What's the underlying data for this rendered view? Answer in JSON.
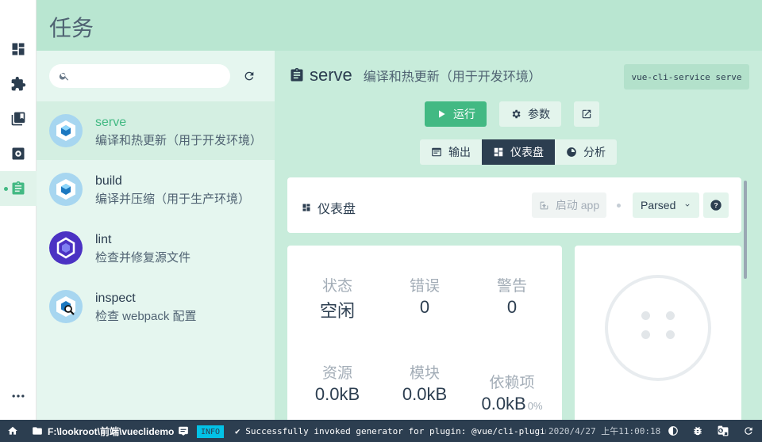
{
  "header": {
    "title": "任务"
  },
  "sidebar": {
    "icons": [
      "dashboard-icon",
      "plugins-icon",
      "dependencies-icon",
      "config-icon",
      "tasks-icon"
    ],
    "more": "more-icon"
  },
  "task_list": {
    "search_placeholder": "",
    "tasks": [
      {
        "name": "serve",
        "desc": "编译和热更新（用于开发环境）",
        "selected": true
      },
      {
        "name": "build",
        "desc": "编译并压缩（用于生产环境）",
        "selected": false
      },
      {
        "name": "lint",
        "desc": "检查并修复源文件",
        "selected": false
      },
      {
        "name": "inspect",
        "desc": "检查 webpack 配置",
        "selected": false
      }
    ]
  },
  "task_detail": {
    "name": "serve",
    "desc": "编译和热更新（用于开发环境）",
    "command": "vue-cli-service serve",
    "run_label": "运行",
    "params_label": "参数",
    "tabs": [
      {
        "label": "输出",
        "active": false
      },
      {
        "label": "仪表盘",
        "active": true
      },
      {
        "label": "分析",
        "active": false
      }
    ]
  },
  "dashboard": {
    "title": "仪表盘",
    "start_app_label": "启动 app",
    "mode_select": "Parsed",
    "stats": [
      {
        "label": "状态",
        "value": "空闲"
      },
      {
        "label": "错误",
        "value": "0"
      },
      {
        "label": "警告",
        "value": "0"
      },
      {
        "label": "资源",
        "value": "0.0kB"
      },
      {
        "label": "模块",
        "value": "0.0kB"
      },
      {
        "label": "依赖项",
        "value": "0.0kB",
        "pct": "0%"
      }
    ]
  },
  "statusbar": {
    "path": "F:\\lookroot\\前端\\vueclidemo",
    "log_level": "INFO",
    "log_message": "✔ Successfully invoked generator for plugin: @vue/cli-plugin-ro…",
    "timestamp": "2020/4/27 上午11:00:18"
  },
  "colors": {
    "accent": "#42b983",
    "dark": "#2c3e50",
    "header_bg": "#b9e6d1",
    "info_badge": "#03c2e6"
  }
}
